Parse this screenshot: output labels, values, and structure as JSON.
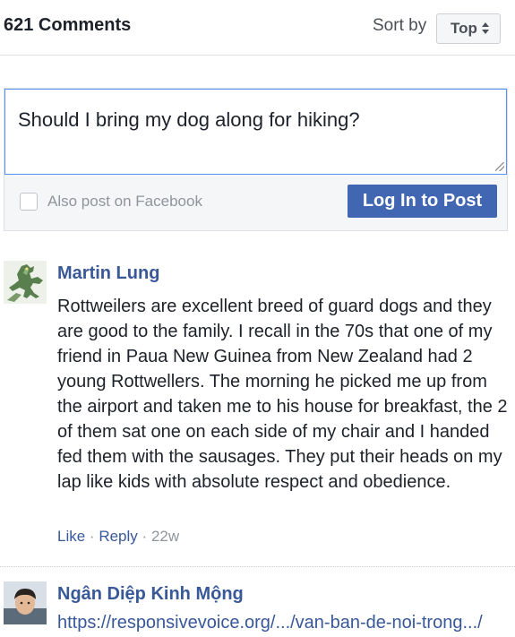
{
  "header": {
    "comment_count": "621 Comments",
    "sort_label": "Sort by",
    "sort_value": "Top"
  },
  "composer": {
    "input_value": "Should I bring my dog along for hiking?",
    "facebook_checkbox_label": "Also post on Facebook",
    "facebook_checkbox_checked": false,
    "post_button_label": "Log In to Post"
  },
  "comments": [
    {
      "author": "Martin Lung",
      "avatar": "dragon-avatar",
      "text": "Rottweilers are excellent breed of guard dogs and they are good to the family. I recall in the 70s that one of my friend in Paua New Guinea from New Zealand had 2 young Rottwellers. The morning he picked me up from the airport and taken me to his house for breakfast, the 2 of them sat one on each side of my chair and I handed fed them with the sausages. They put their heads on my lap like kids with absolute respect and obedience.",
      "like_label": "Like",
      "reply_label": "Reply",
      "separator": "·",
      "age": "22w"
    },
    {
      "author": "Ngân Diệp Kinh Mộng",
      "avatar": "person-avatar",
      "link": "https://responsivevoice.org/.../van-ban-de-noi-trong.../"
    }
  ],
  "colors": {
    "link_blue": "#385898",
    "button_blue": "#4267b2",
    "muted_gray": "#90949c",
    "input_focus_border": "#5890ff"
  }
}
